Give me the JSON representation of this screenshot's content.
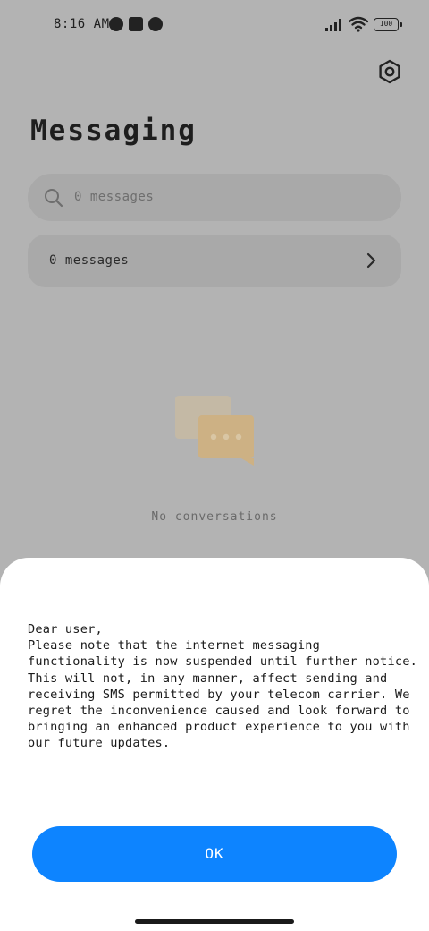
{
  "status_bar": {
    "time": "8:16 AM",
    "battery": "100",
    "icons": [
      "notification-icon",
      "square-notification-icon",
      "notification-icon",
      "signal-icon",
      "wifi-icon",
      "battery-icon"
    ]
  },
  "header": {
    "title": "Messaging",
    "settings_icon": "settings-icon"
  },
  "search": {
    "placeholder": "0 messages"
  },
  "messages_row": {
    "label": "0 messages"
  },
  "empty_state": {
    "text": "No conversations",
    "icon": "chat-bubbles-icon"
  },
  "dialog": {
    "message": "Dear user,\nPlease note that the internet messaging functionality is now suspended until further notice. This will not, in any manner, affect sending and receiving SMS permitted by your telecom carrier. We regret the inconvenience caused and look forward to bringing an enhanced product experience to you with our future updates.",
    "ok_label": "OK"
  },
  "colors": {
    "accent": "#0d84ff",
    "scrim_background": "#b3b3b3",
    "dialog_background": "#ffffff"
  }
}
